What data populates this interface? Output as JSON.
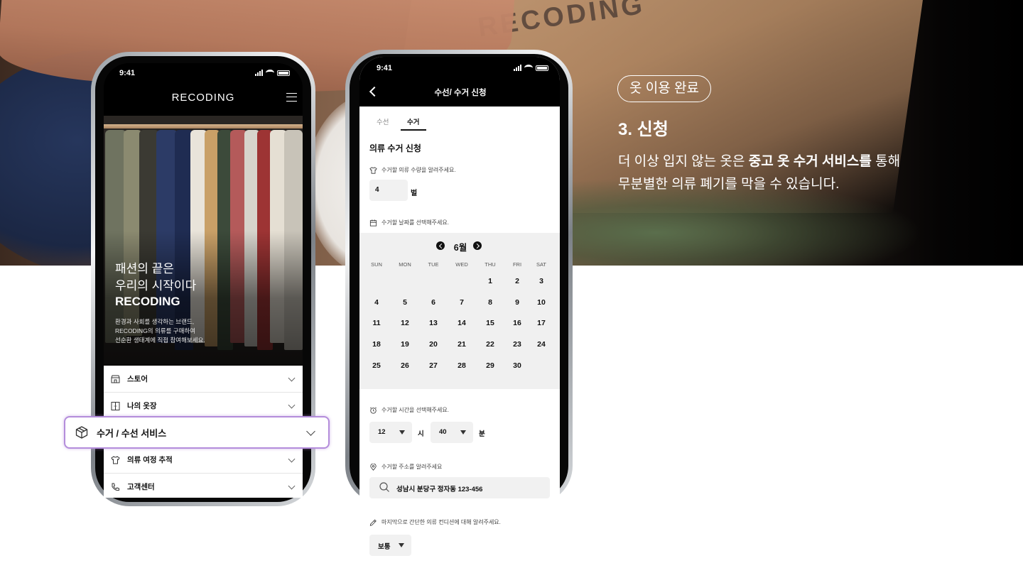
{
  "hero": {
    "box_logo": "RECODING"
  },
  "step": {
    "badge": "옷 이용 완료",
    "title": "3. 신청",
    "desc_pre": "더 이상 입지 않는 옷은 ",
    "desc_bold": "중고 옷 수거 서비스를",
    "desc_post": " 통해",
    "desc_line2": "무분별한 의류 폐기를 막을 수 있습니다."
  },
  "phone1": {
    "time": "9:41",
    "logo": "RECODING",
    "headline_1": "패션의 끝은",
    "headline_2": "우리의 시작이다",
    "brand": "RECODING",
    "sub_1": "환경과 사회를 생각하는 브랜드,",
    "sub_2": "RECODING의 의류를 구매하여",
    "sub_3": "선순환 생태계에 직접 참여해보세요.",
    "menu": [
      {
        "label": "스토어",
        "icon": "store-icon"
      },
      {
        "label": "나의 옷장",
        "icon": "closet-icon"
      },
      {
        "label": "수거 / 수선 서비스",
        "icon": "box-icon"
      },
      {
        "label": "의류 여정 추적",
        "icon": "shirt-icon"
      },
      {
        "label": "고객센터",
        "icon": "phone-icon"
      }
    ]
  },
  "phone2": {
    "time": "9:41",
    "title": "수선/ 수거 신청",
    "tabs": [
      "수선",
      "수거"
    ],
    "active_tab": "수거",
    "section_title": "의류 수거 신청",
    "qty_hint": "수거할 의류 수량을 알려주세요.",
    "qty_value": "4",
    "qty_unit": "벌",
    "date_hint": "수거할 날짜를 선택해주세요.",
    "calendar": {
      "month": "6월",
      "weekdays": [
        "SUN",
        "MON",
        "TUE",
        "WED",
        "THU",
        "FRI",
        "SAT"
      ],
      "first_weekday_index": 4,
      "days_in_month": 30
    },
    "time_hint": "수거할 시간을 선택해주세요.",
    "hour": "12",
    "hour_unit": "시",
    "minute": "40",
    "minute_unit": "분",
    "addr_hint": "수거할 주소를 알려주세요",
    "address": "성남시 분당구 정자동 123-456",
    "cond_hint": "마지막으로 간단한 의류 컨디션에 대해 알려주세요.",
    "condition": "보통"
  }
}
